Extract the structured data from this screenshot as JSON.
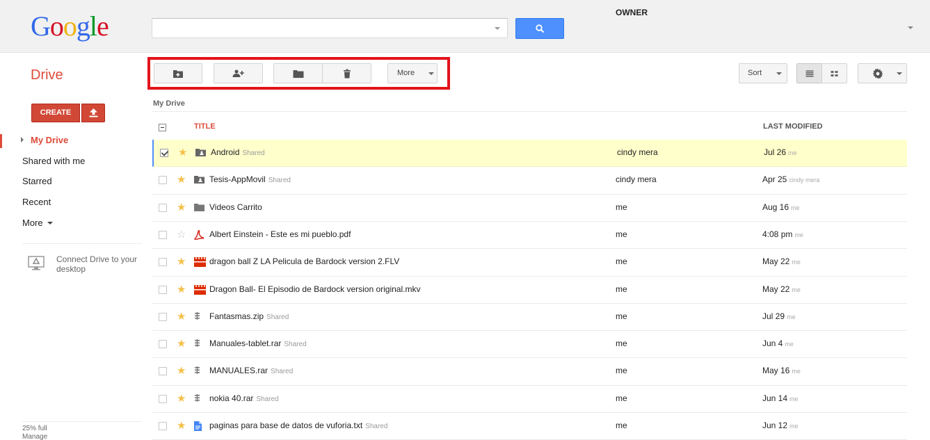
{
  "header": {
    "logo": "Google",
    "search": {
      "value": "",
      "placeholder": ""
    }
  },
  "app": {
    "title": "Drive"
  },
  "toolbar": {
    "more_label": "More",
    "sort_label": "Sort"
  },
  "sidebar": {
    "create_label": "CREATE",
    "nav": [
      "My Drive",
      "Shared with me",
      "Starred",
      "Recent",
      "More"
    ],
    "connect_text": "Connect Drive to your desktop",
    "storage": {
      "usage": "25% full",
      "manage": "Manage"
    }
  },
  "main": {
    "breadcrumb": "My Drive",
    "columns": {
      "title": "TITLE",
      "owner": "OWNER",
      "modified": "LAST MODIFIED"
    },
    "files": [
      {
        "name": "Android",
        "shared": "Shared",
        "type": "shared-folder",
        "starred": true,
        "checked": true,
        "owner": "cindy mera",
        "modified": "Jul 26",
        "modified_by": "me"
      },
      {
        "name": "Tesis-AppMovil",
        "shared": "Shared",
        "type": "shared-folder",
        "starred": true,
        "checked": false,
        "owner": "cindy mera",
        "modified": "Apr 25",
        "modified_by": "cindy mera"
      },
      {
        "name": "Videos Carrito",
        "shared": "",
        "type": "folder",
        "starred": true,
        "checked": false,
        "owner": "me",
        "modified": "Aug 16",
        "modified_by": "me"
      },
      {
        "name": "Albert Einstein - Este es mi pueblo.pdf",
        "shared": "",
        "type": "pdf",
        "starred": false,
        "checked": false,
        "owner": "me",
        "modified": "4:08 pm",
        "modified_by": "me"
      },
      {
        "name": "dragon ball Z LA Pelicula de Bardock version 2.FLV",
        "shared": "",
        "type": "video",
        "starred": true,
        "checked": false,
        "owner": "me",
        "modified": "May 22",
        "modified_by": "me"
      },
      {
        "name": "Dragon Ball- El Episodio de Bardock version original.mkv",
        "shared": "",
        "type": "video",
        "starred": true,
        "checked": false,
        "owner": "me",
        "modified": "May 22",
        "modified_by": "me"
      },
      {
        "name": "Fantasmas.zip",
        "shared": "Shared",
        "type": "archive",
        "starred": true,
        "checked": false,
        "owner": "me",
        "modified": "Jul 29",
        "modified_by": "me"
      },
      {
        "name": "Manuales-tablet.rar",
        "shared": "Shared",
        "type": "archive",
        "starred": true,
        "checked": false,
        "owner": "me",
        "modified": "Jun 4",
        "modified_by": "me"
      },
      {
        "name": "MANUALES.rar",
        "shared": "Shared",
        "type": "archive",
        "starred": true,
        "checked": false,
        "owner": "me",
        "modified": "May 16",
        "modified_by": "me"
      },
      {
        "name": "nokia 40.rar",
        "shared": "Shared",
        "type": "archive",
        "starred": true,
        "checked": false,
        "owner": "me",
        "modified": "Jun 14",
        "modified_by": "me"
      },
      {
        "name": "paginas para base de datos de vuforia.txt",
        "shared": "Shared",
        "type": "text-document",
        "starred": true,
        "checked": false,
        "owner": "me",
        "modified": "Jun 12",
        "modified_by": "me"
      }
    ]
  },
  "colors": {
    "accent_red": "#dd4b39",
    "search_blue": "#4d90fe",
    "star_gold": "#f5c04a",
    "selected_row": "#ffffcc",
    "annotation_box": "#e3131b"
  }
}
